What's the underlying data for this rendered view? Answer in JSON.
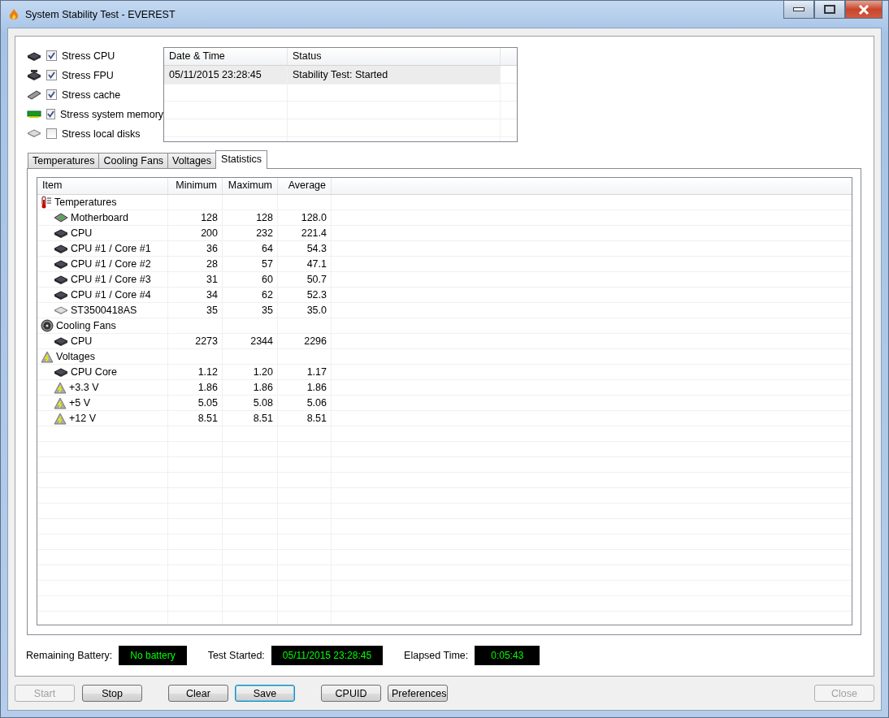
{
  "window": {
    "title": "System Stability Test - EVEREST"
  },
  "stress_options": [
    {
      "label": "Stress CPU",
      "checked": true,
      "kind": "cpu"
    },
    {
      "label": "Stress FPU",
      "checked": true,
      "kind": "fpu"
    },
    {
      "label": "Stress cache",
      "checked": true,
      "kind": "cache"
    },
    {
      "label": "Stress system memory",
      "checked": true,
      "kind": "memory"
    },
    {
      "label": "Stress local disks",
      "checked": false,
      "kind": "disk"
    }
  ],
  "log": {
    "columns": [
      "Date & Time",
      "Status"
    ],
    "rows": [
      {
        "cells": [
          "05/11/2015 23:28:45",
          "Stability Test: Started"
        ],
        "selected": true
      }
    ]
  },
  "tabs": [
    {
      "label": "Temperatures",
      "selected": false
    },
    {
      "label": "Cooling Fans",
      "selected": false
    },
    {
      "label": "Voltages",
      "selected": false
    },
    {
      "label": "Statistics",
      "selected": true
    }
  ],
  "table": {
    "columns": [
      "Item",
      "Minimum",
      "Maximum",
      "Average"
    ],
    "groups": [
      {
        "label": "Temperatures",
        "kind": "temperature",
        "children": [
          {
            "label": "Motherboard",
            "kind": "motherboard",
            "cells": [
              "128",
              "128",
              "128.0"
            ]
          },
          {
            "label": "CPU",
            "kind": "cpu",
            "cells": [
              "200",
              "232",
              "221.4"
            ]
          },
          {
            "label": "CPU #1 / Core #1",
            "kind": "cpu",
            "cells": [
              "36",
              "64",
              "54.3"
            ]
          },
          {
            "label": "CPU #1 / Core #2",
            "kind": "cpu",
            "cells": [
              "28",
              "57",
              "47.1"
            ]
          },
          {
            "label": "CPU #1 / Core #3",
            "kind": "cpu",
            "cells": [
              "31",
              "60",
              "50.7"
            ]
          },
          {
            "label": "CPU #1 / Core #4",
            "kind": "cpu",
            "cells": [
              "34",
              "62",
              "52.3"
            ]
          },
          {
            "label": "ST3500418AS",
            "kind": "disk",
            "cells": [
              "35",
              "35",
              "35.0"
            ]
          }
        ]
      },
      {
        "label": "Cooling Fans",
        "kind": "fan",
        "children": [
          {
            "label": "CPU",
            "kind": "cpu",
            "cells": [
              "2273",
              "2344",
              "2296"
            ]
          }
        ]
      },
      {
        "label": "Voltages",
        "kind": "voltage",
        "children": [
          {
            "label": "CPU Core",
            "kind": "cpu",
            "cells": [
              "1.12",
              "1.20",
              "1.17"
            ]
          },
          {
            "label": "+3.3 V",
            "kind": "voltage",
            "cells": [
              "1.86",
              "1.86",
              "1.86"
            ]
          },
          {
            "label": "+5 V",
            "kind": "voltage",
            "cells": [
              "5.05",
              "5.08",
              "5.06"
            ]
          },
          {
            "label": "+12 V",
            "kind": "voltage",
            "cells": [
              "8.51",
              "8.51",
              "8.51"
            ]
          }
        ]
      }
    ]
  },
  "status": [
    {
      "label": "Remaining Battery:",
      "value": "No battery"
    },
    {
      "label": "Test Started:",
      "value": "05/11/2015 23:28:45"
    },
    {
      "label": "Elapsed Time:",
      "value": "0:05:43"
    }
  ],
  "buttons": [
    {
      "label": "Start",
      "disabled": true,
      "focused": false
    },
    {
      "label": "Stop",
      "disabled": false,
      "focused": false
    },
    {
      "label": "Clear",
      "disabled": false,
      "focused": false
    },
    {
      "label": "Save",
      "disabled": false,
      "focused": true
    },
    {
      "label": "CPUID",
      "disabled": false,
      "focused": false
    },
    {
      "label": "Preferences",
      "disabled": false,
      "focused": false
    },
    {
      "label": "Close",
      "disabled": true,
      "focused": false
    }
  ]
}
